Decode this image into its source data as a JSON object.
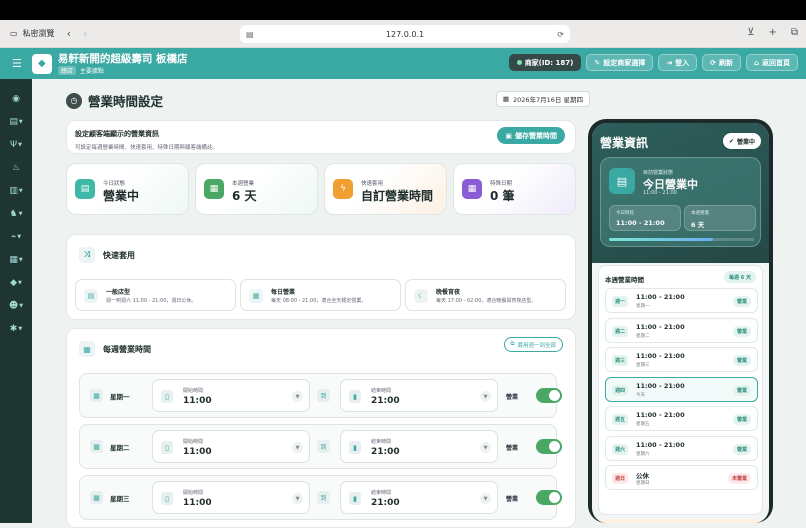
{
  "browser": {
    "private_label": "私密瀏覽",
    "url": "127.0.0.1"
  },
  "header": {
    "store_name": "易軒新開的超級壽司 板橋店",
    "store_tag": "總店",
    "store_sub": "主要據點",
    "buttons": {
      "merchant": "商家(ID: 187)",
      "settings": "設定商家選擇",
      "login": "登入",
      "refresh": "刷新",
      "home": "返回首頁"
    }
  },
  "page": {
    "title": "營業時間設定",
    "date": "2026年7月16日 星期四"
  },
  "settings_header": {
    "title": "設定顧客端顯示的營業資訊",
    "desc": "可設定每週營業時間、快速套用、特殊日期與顧客端備註。",
    "save": "儲存營業時間"
  },
  "stats": [
    {
      "label": "今日狀態",
      "value": "營業中",
      "color": "#3fb8a8",
      "icon": "store-icon"
    },
    {
      "label": "本週營業",
      "value": "6 天",
      "color": "#4aa764",
      "icon": "calendar-icon"
    },
    {
      "label": "快速套用",
      "value": "自訂營業時間",
      "color": "#f0a030",
      "icon": "bolt-icon"
    },
    {
      "label": "特殊日期",
      "value": "0 筆",
      "color": "#8a5cd6",
      "icon": "calendar-special-icon"
    }
  ],
  "quick_apply": {
    "title": "快速套用",
    "items": [
      {
        "title": "一般店型",
        "desc": "週一到週六 11:00 - 21:00，週日公休。"
      },
      {
        "title": "每日營業",
        "desc": "每天 08:00 - 21:00，適合全天穩定營業。"
      },
      {
        "title": "晚餐宵夜",
        "desc": "每天 17:00 - 02:00，適合晚餐與宵夜店型。"
      }
    ]
  },
  "weekly": {
    "title": "每週營業時間",
    "apply_all": "套用週一到全部",
    "open_label": "開始時間",
    "close_label": "結束時間",
    "to_label": "到",
    "status_label": "營業",
    "rows": [
      {
        "day": "星期一",
        "open": "11:00",
        "close": "21:00",
        "enabled": true
      },
      {
        "day": "星期二",
        "open": "11:00",
        "close": "21:00",
        "enabled": true
      },
      {
        "day": "星期三",
        "open": "11:00",
        "close": "21:00",
        "enabled": true
      }
    ]
  },
  "phone": {
    "title": "營業資訊",
    "badge": "營業中",
    "status_small": "目前營業狀態",
    "status_big": "今日營業中",
    "status_time": "11:00 - 21:00",
    "mini1_label": "今日時段",
    "mini1_value": "11:00 - 21:00",
    "mini2_label": "本週營業",
    "mini2_value": "6 天",
    "progress": 0.72,
    "week_title": "本週營業時間",
    "week_badge": "每週 6 天",
    "rows": [
      {
        "tag": "週一",
        "time": "11:00 - 21:00",
        "sub": "星期一",
        "badge": "營業",
        "closed": false,
        "today": false
      },
      {
        "tag": "週二",
        "time": "11:00 - 21:00",
        "sub": "星期二",
        "badge": "營業",
        "closed": false,
        "today": false
      },
      {
        "tag": "週三",
        "time": "11:00 - 21:00",
        "sub": "星期三",
        "badge": "營業",
        "closed": false,
        "today": false
      },
      {
        "tag": "週四",
        "time": "11:00 - 21:00",
        "sub": "今天",
        "badge": "營業",
        "closed": false,
        "today": true
      },
      {
        "tag": "週五",
        "time": "11:00 - 21:00",
        "sub": "星期五",
        "badge": "營業",
        "closed": false,
        "today": false
      },
      {
        "tag": "週六",
        "time": "11:00 - 21:00",
        "sub": "星期六",
        "badge": "營業",
        "closed": false,
        "today": false
      },
      {
        "tag": "週日",
        "time": "公休",
        "sub": "星期日",
        "badge": "未營業",
        "closed": true,
        "today": false
      }
    ]
  }
}
